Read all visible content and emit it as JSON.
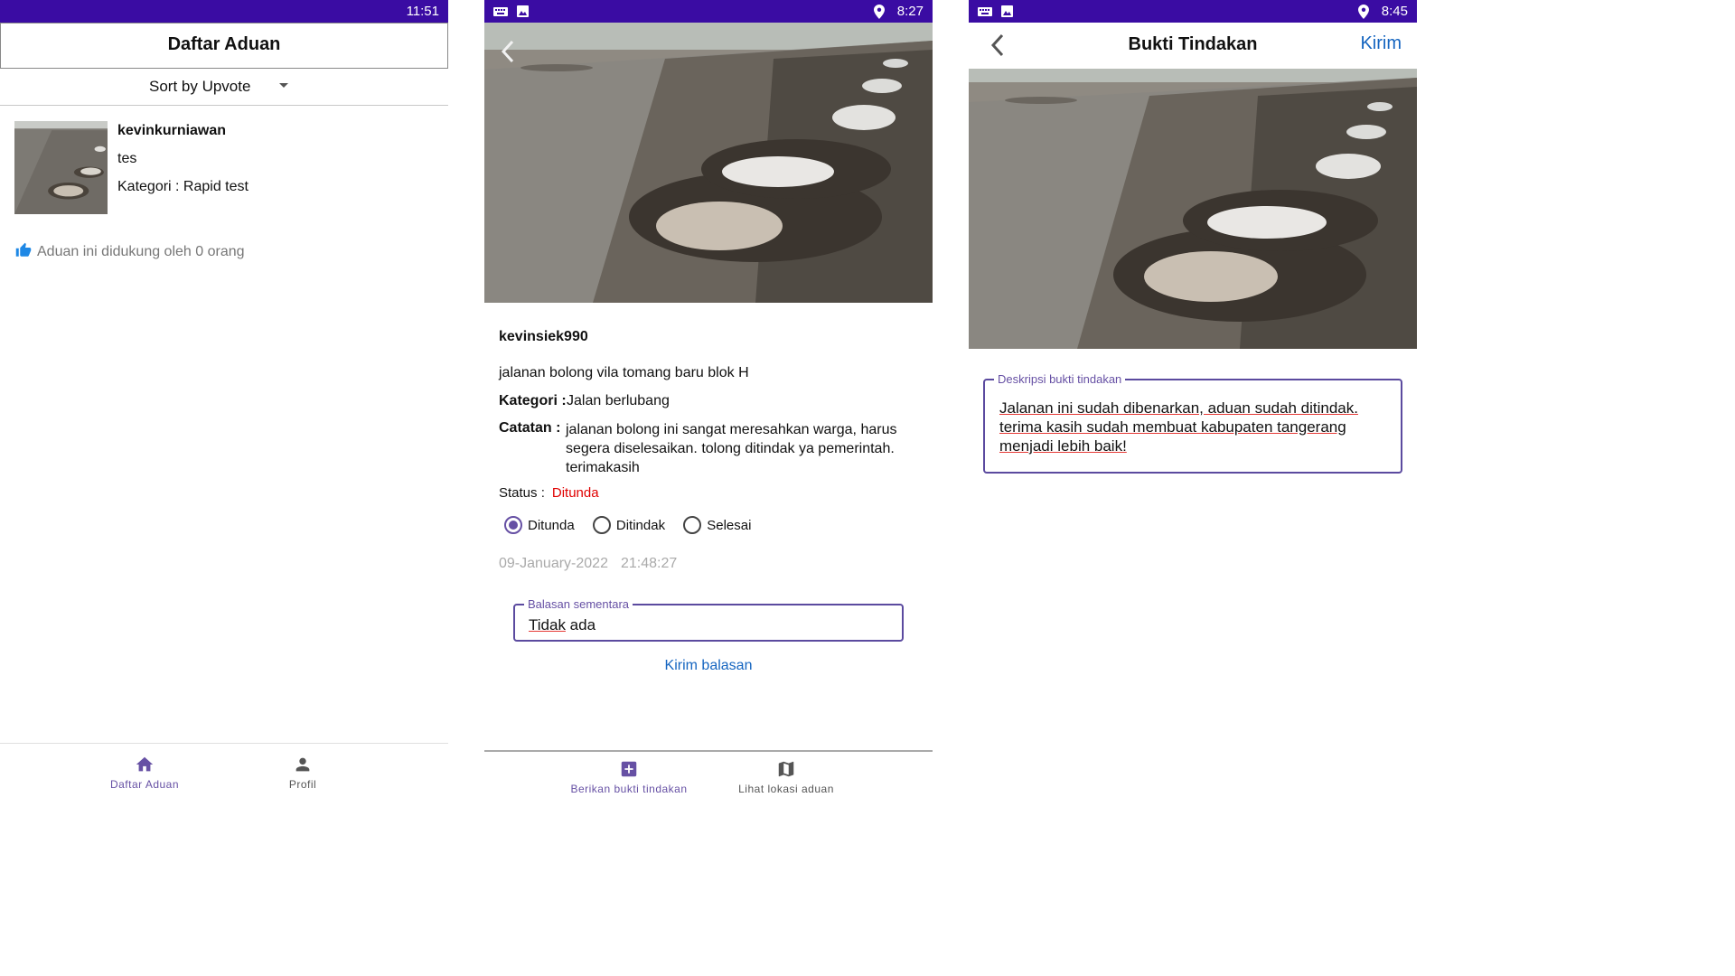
{
  "colors": {
    "status_bar": "#3a0ca3",
    "accent": "#6650a4",
    "link": "#1565c0",
    "status_pending": "#e00000",
    "like_icon": "#1e88e5"
  },
  "panel1": {
    "status_time": "11:51",
    "header_title": "Daftar Aduan",
    "sort_label": "Sort by Upvote",
    "complaint": {
      "username": "kevinkurniawan",
      "text": "tes",
      "category": "Kategori : Rapid test"
    },
    "support_text": "Aduan ini didukung oleh 0 orang",
    "nav": {
      "items": [
        {
          "label": "Daftar Aduan",
          "icon": "home-icon",
          "active": true
        },
        {
          "label": "Profil",
          "icon": "person-icon",
          "active": false
        }
      ]
    }
  },
  "panel2": {
    "status_time": "8:27",
    "username": "kevinsiek990",
    "title": "jalanan bolong vila tomang baru blok H",
    "category_label": "Kategori :",
    "category_value": "Jalan berlubang",
    "notes_label": "Catatan :",
    "notes_value": "jalanan bolong ini sangat meresahkan warga, harus segera diselesaikan. tolong ditindak ya pemerintah. terimakasih",
    "status_label": "Status :",
    "status_value": "Ditunda",
    "status_options": [
      {
        "label": "Ditunda",
        "selected": true
      },
      {
        "label": "Ditindak",
        "selected": false
      },
      {
        "label": "Selesai",
        "selected": false
      }
    ],
    "date": "09-January-2022",
    "time": "21:48:27",
    "reply_field_label": "Balasan sementara",
    "reply_word1": "Tidak",
    "reply_word2": " ada",
    "send_reply": "Kirim balasan",
    "nav": {
      "items": [
        {
          "label": "Berikan bukti tindakan",
          "icon": "add-box-icon"
        },
        {
          "label": "Lihat lokasi aduan",
          "icon": "map-icon"
        }
      ]
    }
  },
  "panel3": {
    "status_time": "8:45",
    "header_title": "Bukti Tindakan",
    "send_label": "Kirim",
    "field_label": "Deskripsi bukti tindakan",
    "field_value": "Jalanan ini sudah dibenarkan, aduan sudah ditindak. terima kasih sudah membuat kabupaten tangerang menjadi lebih baik!"
  }
}
